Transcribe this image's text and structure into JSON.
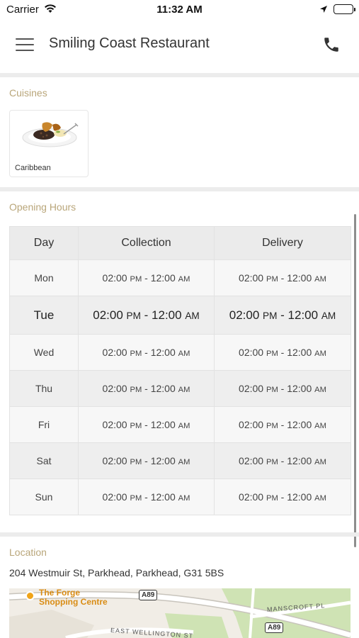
{
  "status_bar": {
    "carrier": "Carrier",
    "time": "11:32 AM"
  },
  "header": {
    "title": "Smiling Coast Restaurant",
    "menu_icon": "hamburger-menu-icon",
    "phone_icon": "phone-icon"
  },
  "cuisines": {
    "label": "Cuisines",
    "items": [
      {
        "name": "Caribbean"
      }
    ]
  },
  "opening_hours": {
    "label": "Opening Hours",
    "columns": [
      "Day",
      "Collection",
      "Delivery"
    ],
    "rows": [
      {
        "day": "Mon",
        "collection_start": "02:00",
        "collection_start_ampm": "PM",
        "collection_end": "12:00",
        "collection_end_ampm": "AM",
        "delivery_start": "02:00",
        "delivery_start_ampm": "PM",
        "delivery_end": "12:00",
        "delivery_end_ampm": "AM"
      },
      {
        "day": "Tue",
        "collection_start": "02:00",
        "collection_start_ampm": "PM",
        "collection_end": "12:00",
        "collection_end_ampm": "AM",
        "delivery_start": "02:00",
        "delivery_start_ampm": "PM",
        "delivery_end": "12:00",
        "delivery_end_ampm": "AM"
      },
      {
        "day": "Wed",
        "collection_start": "02:00",
        "collection_start_ampm": "PM",
        "collection_end": "12:00",
        "collection_end_ampm": "AM",
        "delivery_start": "02:00",
        "delivery_start_ampm": "PM",
        "delivery_end": "12:00",
        "delivery_end_ampm": "AM"
      },
      {
        "day": "Thu",
        "collection_start": "02:00",
        "collection_start_ampm": "PM",
        "collection_end": "12:00",
        "collection_end_ampm": "AM",
        "delivery_start": "02:00",
        "delivery_start_ampm": "PM",
        "delivery_end": "12:00",
        "delivery_end_ampm": "AM"
      },
      {
        "day": "Fri",
        "collection_start": "02:00",
        "collection_start_ampm": "PM",
        "collection_end": "12:00",
        "collection_end_ampm": "AM",
        "delivery_start": "02:00",
        "delivery_start_ampm": "PM",
        "delivery_end": "12:00",
        "delivery_end_ampm": "AM"
      },
      {
        "day": "Sat",
        "collection_start": "02:00",
        "collection_start_ampm": "PM",
        "collection_end": "12:00",
        "collection_end_ampm": "AM",
        "delivery_start": "02:00",
        "delivery_start_ampm": "PM",
        "delivery_end": "12:00",
        "delivery_end_ampm": "AM"
      },
      {
        "day": "Sun",
        "collection_start": "02:00",
        "collection_start_ampm": "PM",
        "collection_end": "12:00",
        "collection_end_ampm": "AM",
        "delivery_start": "02:00",
        "delivery_start_ampm": "PM",
        "delivery_end": "12:00",
        "delivery_end_ampm": "AM"
      }
    ]
  },
  "location": {
    "label": "Location",
    "address": "204 Westmuir St, Parkhead, Parkhead, G31 5BS",
    "map": {
      "poi_line1": "The Forge",
      "poi_line2": "Shopping Centre",
      "road_a89_1": "A89",
      "road_a89_2": "A89",
      "street_manscroft": "MANSCROFT PL",
      "street_east_wellington": "EAST WELLINGTON ST"
    }
  },
  "colors": {
    "section_label": "#b9a67a",
    "poi": "#f0a419",
    "map_green": "#cfe3b4"
  }
}
